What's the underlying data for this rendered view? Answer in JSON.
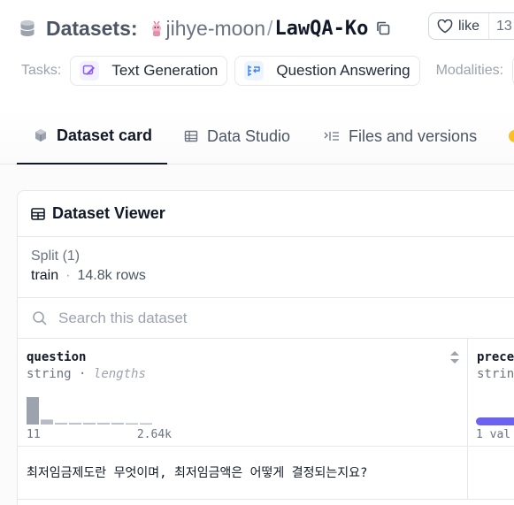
{
  "header": {
    "prefix": "Datasets:",
    "owner": "jihye-moon",
    "separator": "/",
    "repo": "LawQA-Ko",
    "like_label": "like",
    "like_count": "13",
    "tasks_label": "Tasks:",
    "tasks": [
      {
        "label": "Text Generation",
        "icon": "text-generation-icon",
        "color": "#8b5cf6"
      },
      {
        "label": "Question Answering",
        "icon": "question-answering-icon",
        "color": "#3b82f6"
      }
    ],
    "modalities_label": "Modalities:"
  },
  "tabs": [
    {
      "label": "Dataset card",
      "icon": "cube-icon",
      "active": true
    },
    {
      "label": "Data Studio",
      "icon": "table-icon",
      "active": false
    },
    {
      "label": "Files and versions",
      "icon": "files-icon",
      "active": false
    }
  ],
  "viewer": {
    "title": "Dataset Viewer",
    "split_label": "Split (1)",
    "split_name": "train",
    "split_dot": "·",
    "split_rows": "14.8k rows",
    "search_placeholder": "Search this dataset",
    "columns": [
      {
        "name": "question",
        "type": "string",
        "type_sep": "·",
        "type_detail": "lengths",
        "hist_min": "11",
        "hist_max": "2.64k",
        "hist_values": [
          1.0,
          0.18,
          0.06,
          0.06,
          0.06,
          0.06,
          0.06,
          0.04,
          0.04
        ]
      },
      {
        "name": "prece",
        "type": "strin",
        "value_text": "1 val",
        "bar_fraction": 1.0
      }
    ],
    "rows": [
      {
        "question": "최저임금제도란 무엇이며, 최저임금액은 어떻게 결정되는지요?"
      }
    ]
  },
  "colors": {
    "accent_purple": "#6b63f0",
    "hist_bar": "#9ca3af",
    "active_tab": "#111827"
  }
}
